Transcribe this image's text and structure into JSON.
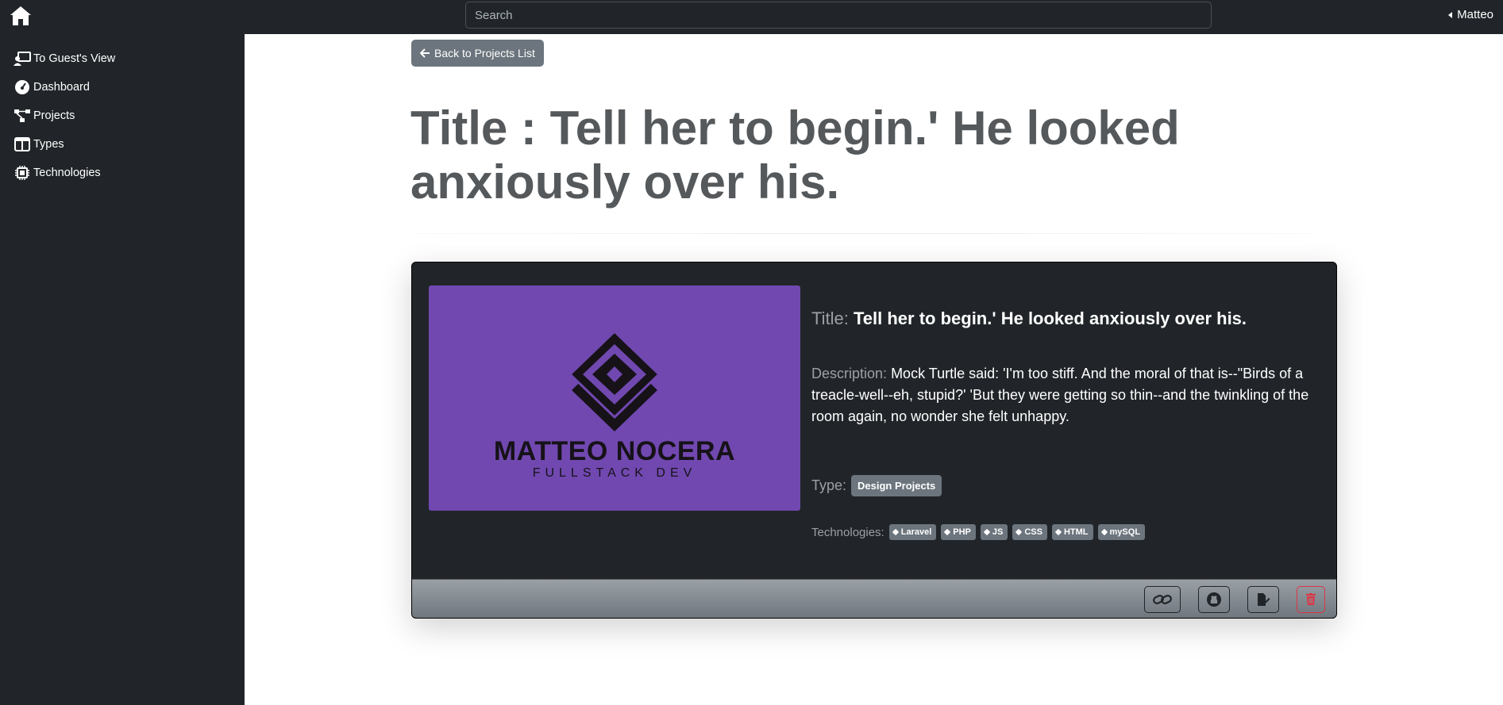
{
  "topbar": {
    "search_placeholder": "Search",
    "user_name": "Matteo"
  },
  "sidebar": {
    "items": [
      {
        "label": "To Guest's View",
        "icon": "guest-view-icon"
      },
      {
        "label": "Dashboard",
        "icon": "dashboard-gauge-icon"
      },
      {
        "label": "Projects",
        "icon": "project-diagram-icon"
      },
      {
        "label": "Types",
        "icon": "table-columns-icon"
      },
      {
        "label": "Technologies",
        "icon": "microchip-icon"
      }
    ]
  },
  "main": {
    "back_label": "Back to Projects List",
    "page_title": "Title : Tell her to begin.' He looked anxiously over his.",
    "card": {
      "logo_name": "MATTEO NOCERA",
      "logo_sub": "FULLSTACK DEV",
      "title_label": "Title:",
      "title_value": "Tell her to begin.' He looked anxiously over his.",
      "description_label": "Description:",
      "description_value": "Mock Turtle said: 'I'm too stiff. And the moral of that is--\"Birds of a treacle-well--eh, stupid?' 'But they were getting so thin--and the twinkling of the room again, no wonder she felt unhappy.",
      "type_label": "Type:",
      "type_value": "Design Projects",
      "technologies_label": "Technologies:",
      "technologies": [
        "Laravel",
        "PHP",
        "JS",
        "CSS",
        "HTML",
        "mySQL"
      ],
      "footer_buttons": [
        "link-icon",
        "github-icon",
        "edit-icon",
        "trash-icon"
      ]
    }
  },
  "colors": {
    "dark": "#212529",
    "secondary": "#6c757d",
    "logo_bg": "#7148b0",
    "danger": "#dc3545"
  }
}
